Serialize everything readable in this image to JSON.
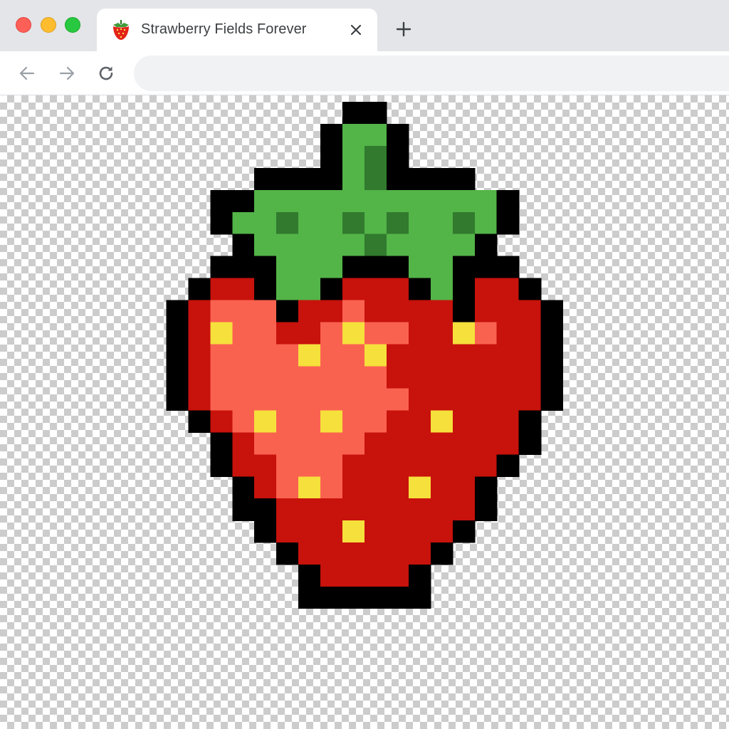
{
  "window": {
    "traffic_lights": {
      "close": "#fe5f57",
      "minimize": "#febc2e",
      "maximize": "#28c840"
    }
  },
  "tab": {
    "title": "Strawberry Fields Forever",
    "favicon": "strawberry-icon",
    "close_icon": "close-icon"
  },
  "toolbar": {
    "back_icon": "arrow-left-icon",
    "forward_icon": "arrow-right-icon",
    "reload_icon": "reload-icon",
    "address": {
      "value": "",
      "placeholder": ""
    }
  },
  "content": {
    "background": "transparency-checkerboard",
    "image": {
      "subject": "pixel-art strawberry",
      "palette": {
        "outline": "#000000",
        "leaf": "#53b448",
        "leaf_dark": "#317a2e",
        "red": "#f24a3c",
        "red_light": "#fa6250",
        "red_dark": "#c8120c",
        "seed": "#f6e03c"
      }
    }
  }
}
